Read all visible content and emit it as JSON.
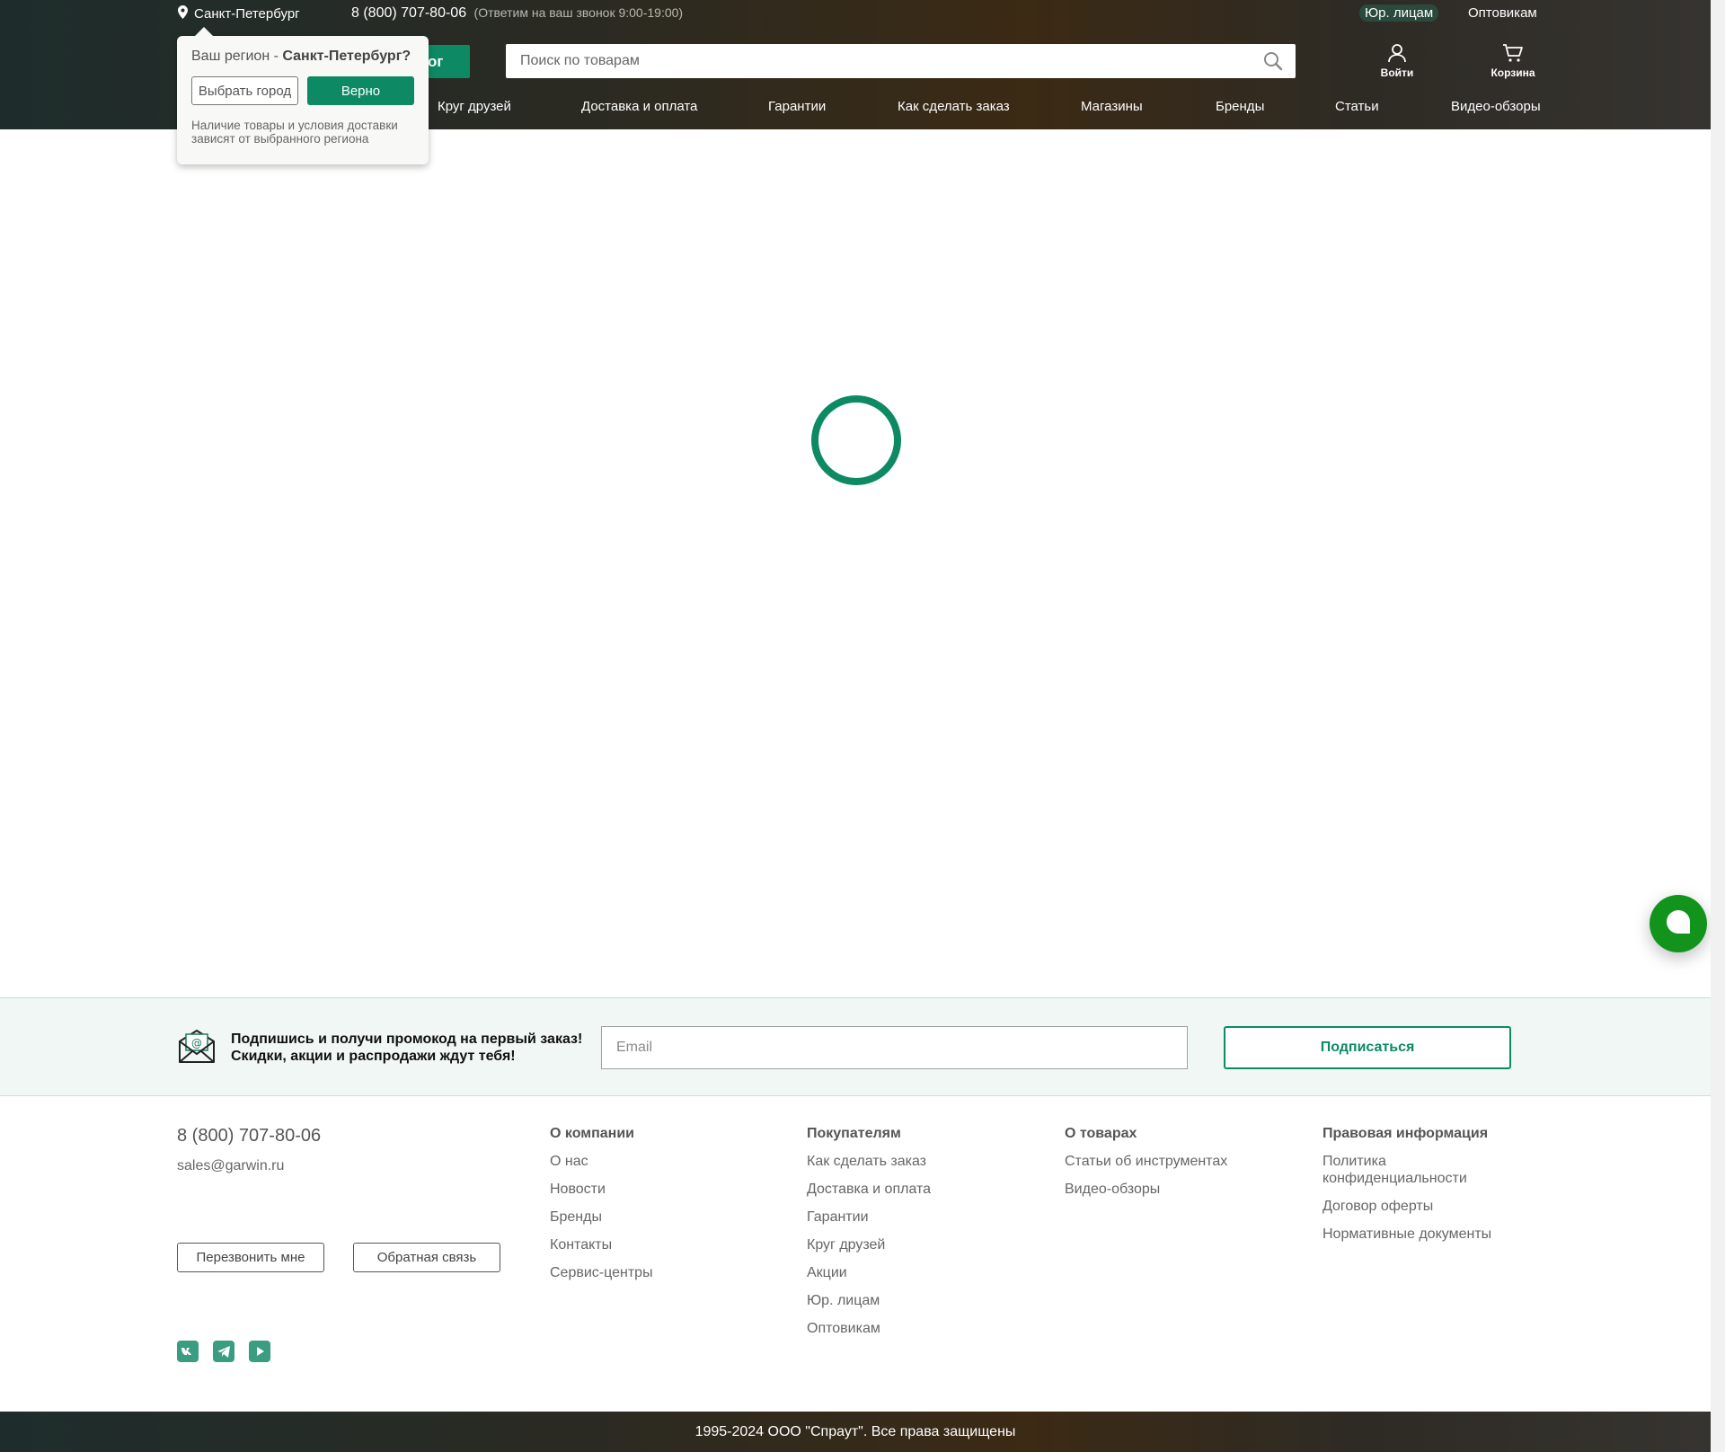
{
  "header": {
    "city": "Санкт-Петербург",
    "phone": "8 (800) 707-80-06",
    "phone_hours": "(Ответим на ваш звонок 9:00-19:00)",
    "legal_link": "Юр. лицам",
    "wholesale_link": "Оптовикам",
    "catalog_label": "алог",
    "search_placeholder": "Поиск по товарам",
    "login_label": "Войти",
    "cart_label": "Корзина",
    "nav": [
      "Круг друзей",
      "Доставка и оплата",
      "Гарантии",
      "Как сделать заказ",
      "Магазины",
      "Бренды",
      "Статьи",
      "Видео-обзоры"
    ]
  },
  "region_popup": {
    "question_prefix": "Ваш регион - ",
    "question_city": "Санкт-Петербург?",
    "choose_button": "Выбрать город",
    "confirm_button": "Верно",
    "note": "Наличие товары и условия доставки зависят от выбранного региона"
  },
  "subscribe": {
    "line1": "Подпишись и получи промокод на первый заказ!",
    "line2": "Скидки, акции и распродажи ждут тебя!",
    "email_placeholder": "Email",
    "button": "Подписаться"
  },
  "footer": {
    "phone": "8 (800) 707-80-06",
    "email": "sales@garwin.ru",
    "callback_button": "Перезвонить мне",
    "feedback_button": "Обратная связь",
    "socials": [
      "vk-icon",
      "telegram-icon",
      "youtube-icon"
    ],
    "columns": [
      {
        "title": "О компании",
        "items": [
          "О нас",
          "Новости",
          "Бренды",
          "Контакты",
          "Сервис-центры"
        ]
      },
      {
        "title": "Покупателям",
        "items": [
          "Как сделать заказ",
          "Доставка и оплата",
          "Гарантии",
          "Круг друзей",
          "Акции",
          "Юр. лицам",
          "Оптовикам"
        ]
      },
      {
        "title": "О товарах",
        "items": [
          "Статьи об инструментах",
          "Видео-обзоры"
        ]
      },
      {
        "title": "Правовая информация",
        "items": [
          "Политика конфиденциальности",
          "Договор оферты",
          "Нормативные документы"
        ]
      }
    ],
    "copyright": "1995-2024 ООО \"Спраут\". Все права защищены"
  },
  "colors": {
    "accent": "#0d8a63",
    "chat": "#12941c"
  }
}
